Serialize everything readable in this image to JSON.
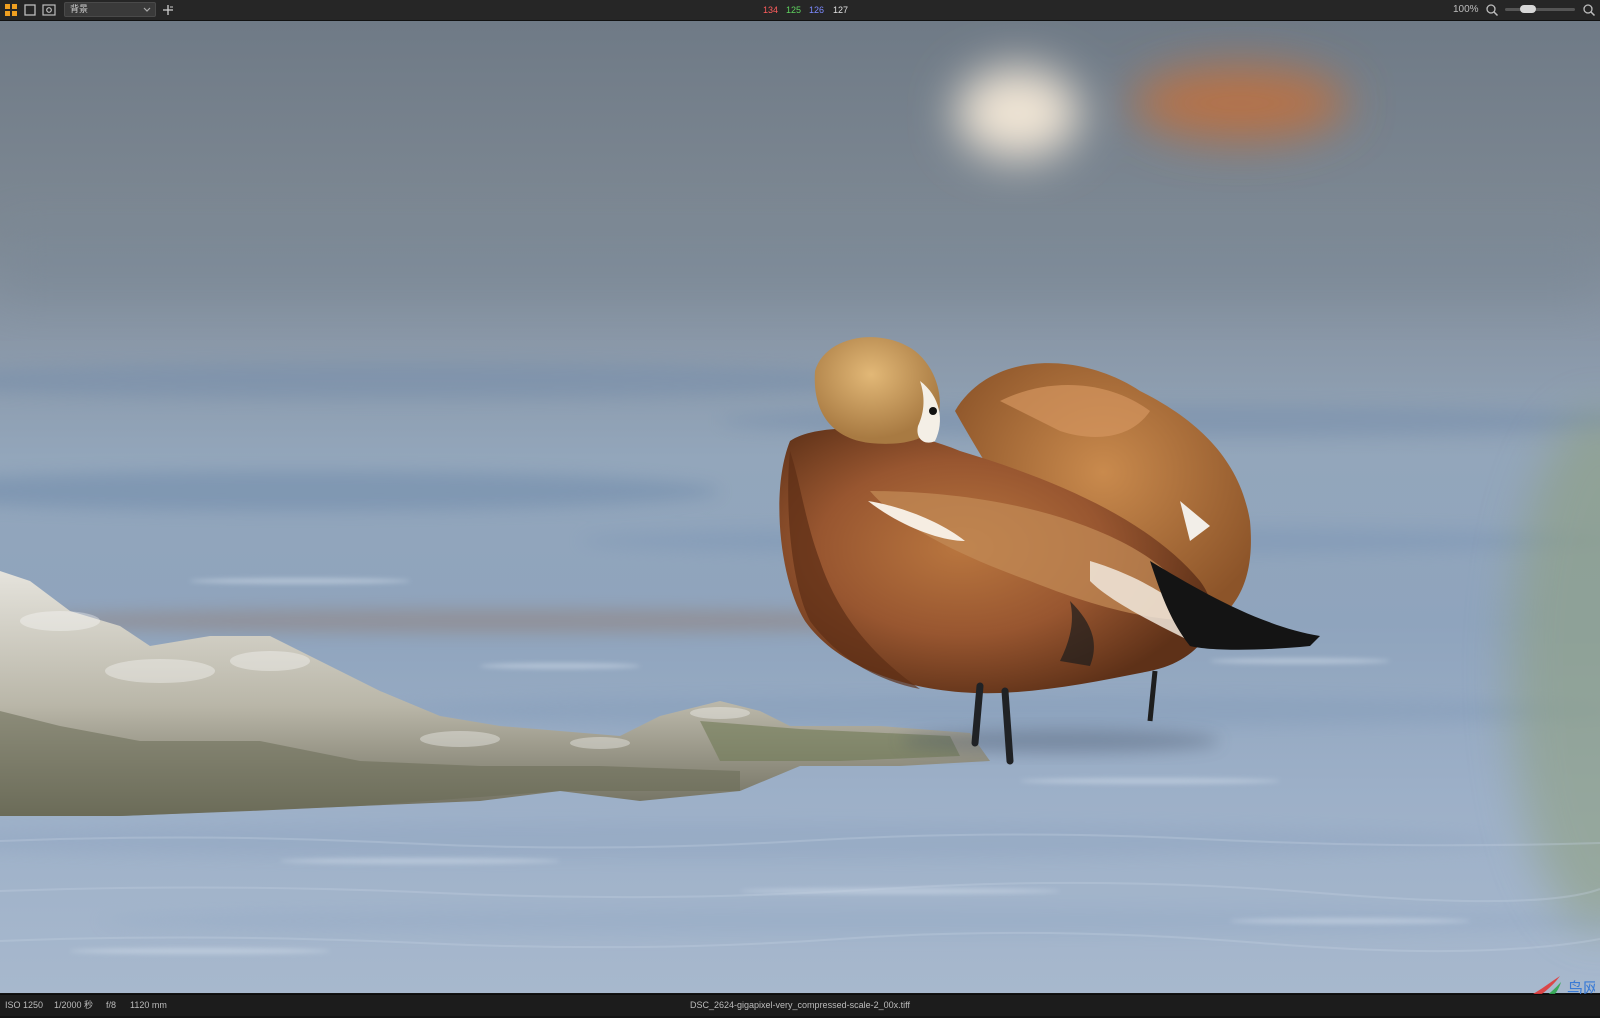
{
  "toolbar": {
    "layer_name": "背景",
    "icons": [
      "layout-grid-icon",
      "single-view-icon",
      "preview-eye-icon",
      "add-plus-icon",
      "zoom-out-icon",
      "zoom-in-icon"
    ],
    "rgb": {
      "r": "134",
      "g": "125",
      "b": "126",
      "a": "127"
    },
    "zoom_label": "100%",
    "zoom_level_percent": 100
  },
  "status": {
    "iso": "ISO 1250",
    "shutter": "1/2000 秒",
    "aperture": "f/8",
    "focal_length": "1120 mm",
    "filename": "DSC_2624-gigapixel-very_compressed-scale-2_00x.tiff"
  },
  "watermark": {
    "text": "鸟网"
  },
  "colors": {
    "red": "#ff5d5d",
    "green": "#5fd35f",
    "blue": "#7d8bff",
    "white": "#e0e0e0"
  }
}
